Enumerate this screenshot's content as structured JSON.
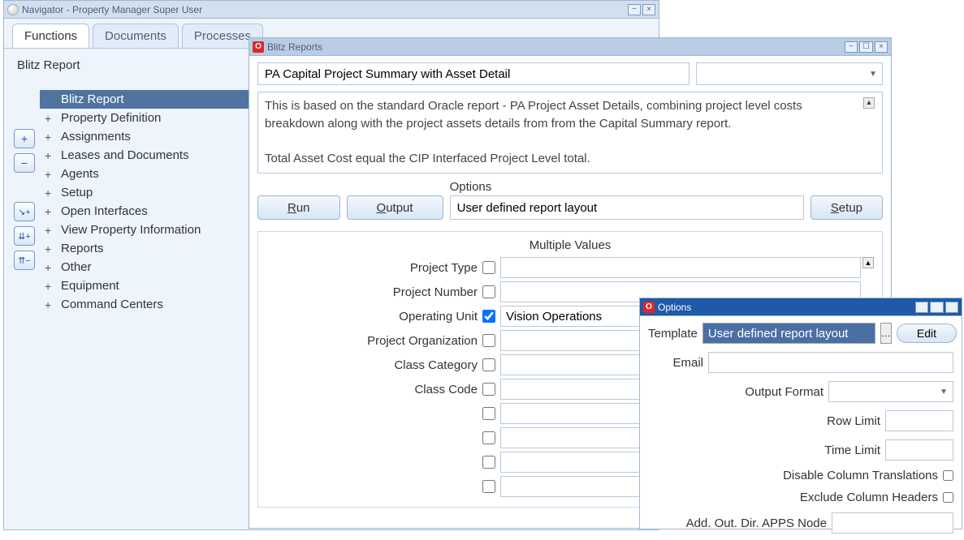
{
  "navigator": {
    "title": "Navigator - Property Manager Super User",
    "tabs": [
      "Functions",
      "Documents",
      "Processes"
    ],
    "active_tab": 0,
    "breadcrumb": "Blitz Report",
    "tree": [
      {
        "expand": "",
        "label": "Blitz Report",
        "selected": true
      },
      {
        "expand": "+",
        "label": "Property Definition"
      },
      {
        "expand": "+",
        "label": "Assignments"
      },
      {
        "expand": "+",
        "label": "Leases and Documents"
      },
      {
        "expand": "+",
        "label": "Agents"
      },
      {
        "expand": "+",
        "label": "Setup"
      },
      {
        "expand": "+",
        "label": "Open Interfaces"
      },
      {
        "expand": "+",
        "label": "View Property Information"
      },
      {
        "expand": "+",
        "label": "Reports"
      },
      {
        "expand": "+",
        "label": "Other"
      },
      {
        "expand": "+",
        "label": "Equipment"
      },
      {
        "expand": "+",
        "label": "Command Centers"
      }
    ],
    "side_buttons": [
      "+",
      "−",
      "↘+",
      "⇊+",
      "⇈−"
    ]
  },
  "blitz": {
    "title": "Blitz Reports",
    "report_name": "PA Capital Project Summary with Asset Detail",
    "category": "",
    "description": "This is based on the standard Oracle report - PA Project Asset Details, combining project level costs breakdown along with the project assets details from  from the Capital Summary report.\n\nTotal Asset Cost equal the CIP Interfaced Project Level total.",
    "run_label": "Run",
    "output_label": "Output",
    "options_label": "Options",
    "options_value": "User defined report layout",
    "setup_label": "Setup",
    "params_header": "Multiple Values",
    "params": [
      {
        "label": "Project Type",
        "checked": false,
        "value": ""
      },
      {
        "label": "Project Number",
        "checked": false,
        "value": ""
      },
      {
        "label": "Operating Unit",
        "checked": true,
        "value": "Vision Operations"
      },
      {
        "label": "Project Organization",
        "checked": false,
        "value": ""
      },
      {
        "label": "Class Category",
        "checked": false,
        "value": ""
      },
      {
        "label": "Class Code",
        "checked": false,
        "value": ""
      },
      {
        "label": "",
        "checked": false,
        "value": ""
      },
      {
        "label": "",
        "checked": false,
        "value": ""
      },
      {
        "label": "",
        "checked": false,
        "value": ""
      },
      {
        "label": "",
        "checked": false,
        "value": ""
      }
    ]
  },
  "options": {
    "title": "Options",
    "template_label": "Template",
    "template_value": "User defined report layout",
    "edit_label": "Edit",
    "email_label": "Email",
    "email_value": "",
    "output_format_label": "Output Format",
    "output_format_value": "",
    "row_limit_label": "Row Limit",
    "row_limit_value": "",
    "time_limit_label": "Time Limit",
    "time_limit_value": "",
    "disable_col_label": "Disable Column Translations",
    "disable_col_checked": false,
    "exclude_hdr_label": "Exclude Column Headers",
    "exclude_hdr_checked": false,
    "add_dir_label": "Add. Out. Dir. APPS Node",
    "add_dir_value": ""
  }
}
